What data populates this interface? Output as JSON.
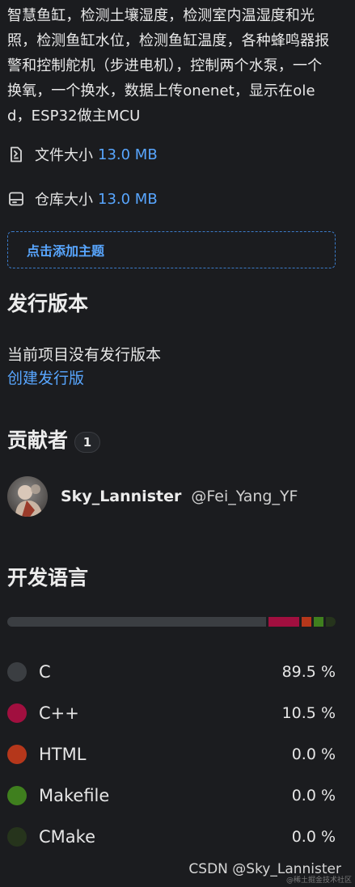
{
  "description": "智慧鱼缸，检测土壤湿度，检测室内温湿度和光照，检测鱼缸水位，检测鱼缸温度，各种蜂鸣器报警和控制舵机（步进电机），控制两个水泵，一个换氧，一个换水，数据上传onenet，显示在oled，ESP32做主MCU",
  "meta": {
    "file_size_label": "文件大小",
    "file_size_value": "13.0 MB",
    "file_size_icon": "file-zip-icon",
    "repo_size_label": "仓库大小",
    "repo_size_value": "13.0 MB",
    "repo_size_icon": "database-icon"
  },
  "topic": {
    "add_label": "点击添加主题"
  },
  "releases": {
    "title": "发行版本",
    "empty_text": "当前项目没有发行版本",
    "create_link": "创建发行版"
  },
  "contributors": {
    "title": "贡献者",
    "count": "1",
    "items": [
      {
        "name": "Sky_Lannister",
        "handle": "@Fei_Yang_YF",
        "avatar_icon": "user-avatar"
      }
    ]
  },
  "languages": {
    "title": "开发语言",
    "items": [
      {
        "name": "C",
        "percent": "89.5 %",
        "share": 89.5,
        "color": "#3b3e42"
      },
      {
        "name": "C++",
        "percent": "10.5 %",
        "share": 10.5,
        "color": "#a10f3f"
      },
      {
        "name": "HTML",
        "percent": "0.0 %",
        "share": 0.0,
        "color": "#b5371b"
      },
      {
        "name": "Makefile",
        "percent": "0.0 %",
        "share": 0.0,
        "color": "#3f7f1e"
      },
      {
        "name": "CMake",
        "percent": "0.0 %",
        "share": 0.0,
        "color": "#26341c"
      }
    ]
  },
  "watermark": {
    "text": "CSDN @Sky_Lannister",
    "small_text": "@稀土掘金技术社区"
  }
}
